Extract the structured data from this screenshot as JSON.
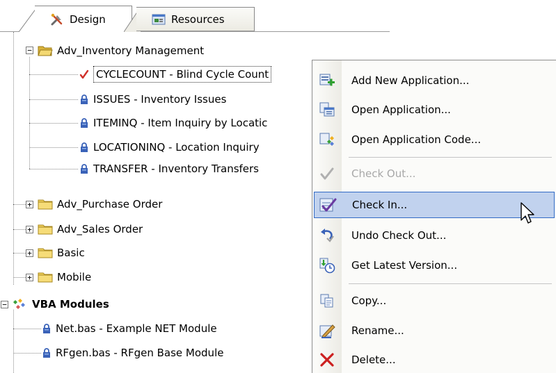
{
  "tabs": [
    {
      "label": "Design",
      "icon": "tools-icon",
      "active": true
    },
    {
      "label": "Resources",
      "icon": "resources-icon",
      "active": false
    }
  ],
  "tree": {
    "adv_inventory": {
      "label": "Adv_Inventory Management",
      "expander": "−",
      "children": [
        {
          "label": "CYCLECOUNT - Blind Cycle Count",
          "icon": "checkmark-icon",
          "selected": true
        },
        {
          "label": "ISSUES - Inventory Issues",
          "icon": "lock-icon"
        },
        {
          "label": "ITEMINQ - Item Inquiry by Locatic",
          "icon": "lock-icon"
        },
        {
          "label": "LOCATIONINQ - Location Inquiry",
          "icon": "lock-icon"
        },
        {
          "label": "TRANSFER - Inventory Transfers",
          "icon": "lock-icon"
        }
      ]
    },
    "folders": [
      {
        "label": "Adv_Purchase Order",
        "expander": "+"
      },
      {
        "label": "Adv_Sales Order",
        "expander": "+"
      },
      {
        "label": "Basic",
        "expander": "+"
      },
      {
        "label": "Mobile",
        "expander": "+"
      }
    ],
    "vba": {
      "label": "VBA Modules",
      "expander": "−",
      "children": [
        {
          "label": "Net.bas - Example NET Module",
          "icon": "lock-icon"
        },
        {
          "label": "RFgen.bas - RFgen Base Module",
          "icon": "lock-icon"
        }
      ]
    }
  },
  "menu": {
    "items": [
      {
        "label": "Add New Application...",
        "icon": "add-application-icon",
        "disabled": false
      },
      {
        "label": "Open Application...",
        "icon": "open-application-icon",
        "disabled": false
      },
      {
        "label": "Open Application Code...",
        "icon": "open-code-icon",
        "disabled": false
      },
      {
        "label": "Check Out...",
        "icon": "check-out-icon",
        "disabled": true
      },
      {
        "label": "Check In...",
        "icon": "check-in-icon",
        "disabled": false,
        "hover": true
      },
      {
        "label": "Undo Check Out...",
        "icon": "undo-icon",
        "disabled": false
      },
      {
        "label": "Get Latest Version...",
        "icon": "get-latest-icon",
        "disabled": false
      },
      {
        "label": "Copy...",
        "icon": "copy-icon",
        "disabled": false
      },
      {
        "label": "Rename...",
        "icon": "rename-icon",
        "disabled": false
      },
      {
        "label": "Delete...",
        "icon": "delete-icon",
        "disabled": false
      }
    ]
  },
  "colors": {
    "hover_bg": "#c1d2ee",
    "hover_border": "#316ac5",
    "folder": "#e8c547",
    "lock": "#3a62b8",
    "check": "#d0302a",
    "delete": "#cc2020"
  }
}
